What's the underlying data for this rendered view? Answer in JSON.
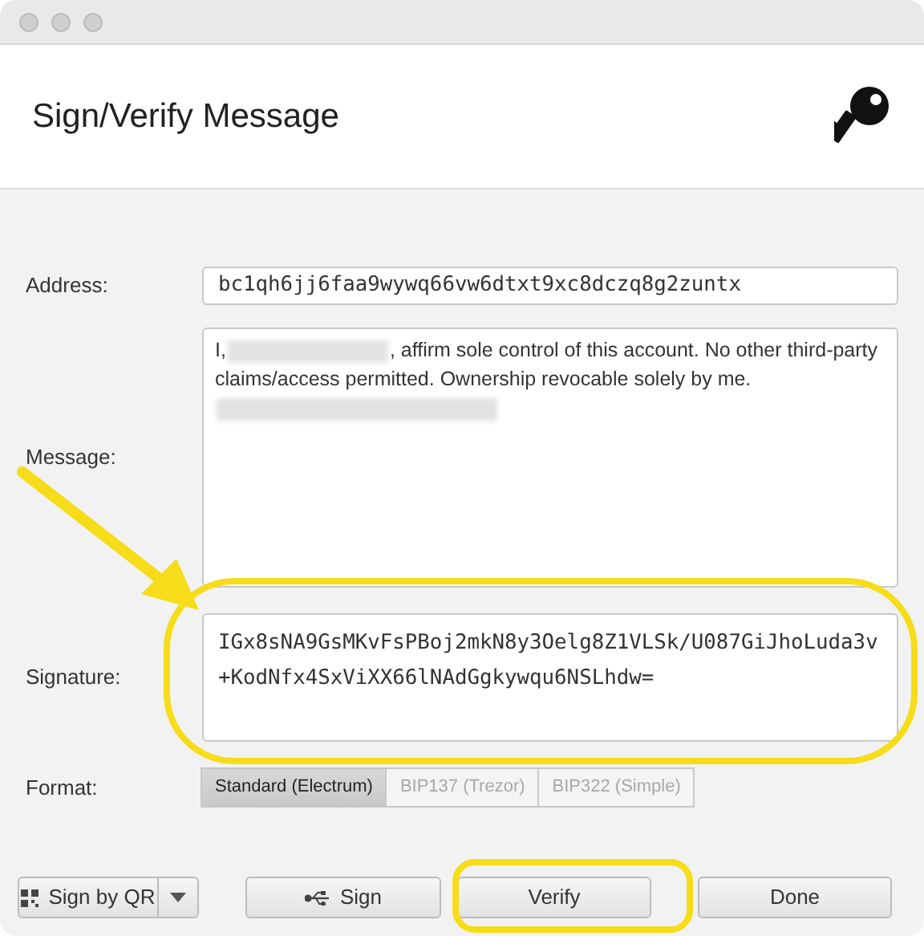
{
  "window": {
    "title": "Sign/Verify Message"
  },
  "fields": [
    {
      "kind": "address",
      "label": "Address:",
      "value": "bc1qh6jj6faa9wywq66vw6dtxt9xc8dczq8g2zuntx"
    },
    {
      "kind": "message",
      "label": "Message:",
      "parts": [
        {
          "kind": "text",
          "text": "I,"
        },
        {
          "kind": "redacted"
        },
        {
          "kind": "text",
          "text": ", affirm sole control of this account. No other third-party"
        },
        {
          "kind": "break"
        },
        {
          "kind": "text",
          "text": "claims/access permitted. Ownership revocable solely by me."
        },
        {
          "kind": "break"
        },
        {
          "kind": "redacted"
        }
      ]
    },
    {
      "kind": "signature",
      "label": "Signature:",
      "value": "IGx8sNA9GsMKvFsPBoj2mkN8y3Oelg8Z1VLSk/U087GiJhoLuda3v+KodNfx4SxViXX66lNAdGgkywqu6NSLhdw="
    }
  ],
  "format": {
    "label": "Format:",
    "options": [
      {
        "label": "Standard (Electrum)",
        "selected": true,
        "disabled": false
      },
      {
        "label": "BIP137 (Trezor)",
        "selected": false,
        "disabled": true
      },
      {
        "label": "BIP322 (Simple)",
        "selected": false,
        "disabled": true
      }
    ]
  },
  "buttons": [
    {
      "kind": "qr",
      "label": "Sign by QR"
    },
    {
      "kind": "usb",
      "label": "Sign"
    },
    {
      "kind": "plain",
      "label": "Verify"
    },
    {
      "kind": "plain",
      "label": "Done"
    }
  ]
}
